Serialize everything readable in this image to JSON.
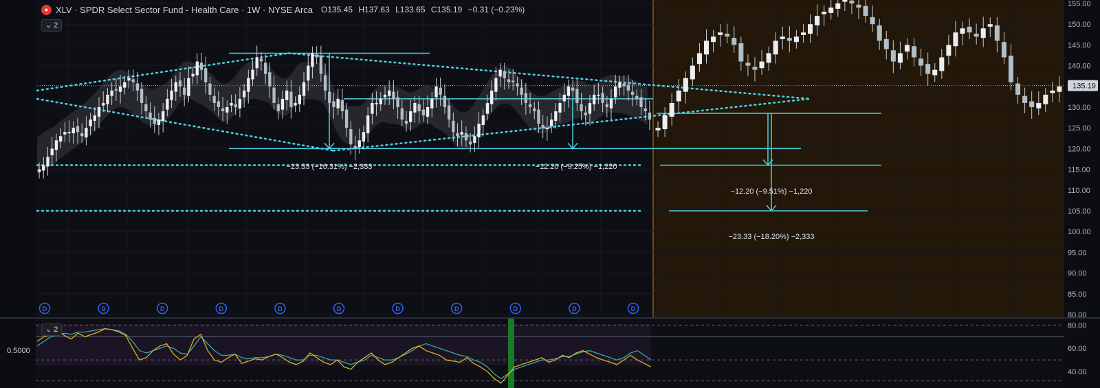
{
  "header": {
    "logo": "●",
    "title": "XLV · SPDR Select Sector Fund - Health Care · 1W · NYSE Arca",
    "open": "O135.45",
    "high": "H137.63",
    "low": "L133.65",
    "close": "C135.19",
    "change": "−0.31 (−0.23%)"
  },
  "main_pane": {
    "collapse_label": "2"
  },
  "osc_pane": {
    "collapse_label": "2",
    "left_label": "0.5000"
  },
  "price_axis": {
    "labels": [
      "155.00",
      "150.00",
      "145.00",
      "140.00",
      "135.00",
      "130.00",
      "125.00",
      "120.00",
      "115.00",
      "110.00",
      "105.00",
      "100.00",
      "95.00",
      "90.00",
      "85.00",
      "80.00"
    ],
    "last_price": "135.19"
  },
  "osc_axis": {
    "labels": [
      "80.00",
      "60.00",
      "40.00"
    ]
  },
  "annotations": [
    "−23.33 (−16.31%) −2,333",
    "−12.20 (−9.25%) −1,220",
    "−12.20 (−9.51%) −1,220",
    "−23.33 (−18.20%) −2,333"
  ],
  "dividend_marker": "D",
  "colors": {
    "background": "#0c0d12",
    "projection": "#221708",
    "projection_border": "#8a5a20",
    "drawing": "#4dd0e1",
    "candle_up": "#eceff1",
    "candle_down": "#b0bec5",
    "band": "#2a2b31",
    "osc_fast": "#e0b020",
    "osc_slow": "#3aa7a0",
    "osc_highlight": "#1b7a28",
    "accent_red": "#e53935"
  },
  "chart_data": {
    "type": "candlestick",
    "y_scale": {
      "min": 80,
      "max": 155
    },
    "last_close": 135.19,
    "weekly_closes": [
      115,
      116,
      118,
      120,
      122,
      123,
      124,
      124,
      125,
      124,
      123,
      125,
      127,
      128,
      130,
      131,
      133,
      134,
      134,
      135,
      136,
      137,
      136,
      134,
      131,
      129,
      127,
      126,
      127,
      129,
      132,
      134,
      136,
      135,
      133,
      137,
      138,
      141,
      139,
      136,
      133,
      131,
      130,
      129,
      130,
      131,
      130,
      132,
      134,
      137,
      139,
      142,
      141,
      138,
      135,
      131,
      129,
      132,
      134,
      130,
      131,
      133,
      136,
      140,
      143,
      142,
      138,
      134,
      131,
      130,
      132,
      129,
      125,
      121,
      120,
      122,
      124,
      128,
      131,
      131,
      132,
      133,
      134,
      132,
      130,
      127,
      126,
      129,
      131,
      129,
      128,
      130,
      132,
      135,
      133,
      130,
      127,
      124,
      123,
      124,
      122,
      121,
      123,
      126,
      128,
      131,
      134,
      137,
      139,
      137,
      136,
      136,
      135,
      133,
      131,
      130,
      129,
      126,
      125,
      125,
      127,
      129,
      131,
      133,
      135,
      134,
      131,
      129,
      128,
      131,
      133,
      133,
      131,
      130,
      132,
      135,
      136,
      135,
      134,
      133,
      132,
      130,
      129,
      127
    ],
    "projection_closes": [
      125,
      128,
      131,
      134,
      137,
      140,
      143,
      146,
      147,
      148,
      147,
      145,
      141,
      140,
      139,
      141,
      143,
      146,
      147,
      146,
      147,
      148,
      150,
      152,
      153,
      154,
      155,
      156,
      155,
      154,
      152,
      150,
      146,
      144,
      141,
      143,
      145,
      142,
      140,
      138,
      139,
      142,
      145,
      148,
      149,
      148,
      147,
      149,
      150,
      146,
      142,
      136,
      133,
      131,
      130,
      131,
      133,
      134,
      135
    ]
  },
  "osc_data": {
    "fast": [
      66,
      70,
      72,
      75,
      71,
      68,
      73,
      70,
      72,
      74,
      77,
      76,
      74,
      71,
      60,
      50,
      52,
      58,
      62,
      64,
      55,
      50,
      54,
      68,
      72,
      58,
      50,
      48,
      52,
      55,
      47,
      49,
      51,
      50,
      53,
      55,
      52,
      48,
      46,
      49,
      56,
      52,
      48,
      46,
      50,
      44,
      42,
      48,
      52,
      56,
      50,
      46,
      48,
      52,
      56,
      60,
      62,
      58,
      56,
      54,
      50,
      49,
      48,
      52,
      47,
      44,
      40,
      34,
      30,
      37,
      44,
      46,
      48,
      50,
      52,
      48,
      50,
      54,
      52,
      56,
      58,
      55,
      52,
      50,
      48,
      46,
      50,
      54,
      50,
      47,
      44
    ],
    "slow": [
      62,
      66,
      70,
      72,
      73,
      72,
      74,
      74,
      75,
      76,
      77,
      76,
      75,
      72,
      66,
      58,
      56,
      58,
      60,
      62,
      60,
      56,
      55,
      62,
      70,
      64,
      58,
      54,
      54,
      55,
      52,
      51,
      52,
      52,
      53,
      55,
      54,
      52,
      50,
      50,
      54,
      54,
      52,
      50,
      50,
      48,
      46,
      48,
      50,
      54,
      52,
      50,
      50,
      52,
      55,
      58,
      62,
      64,
      62,
      60,
      58,
      56,
      54,
      53,
      50,
      48,
      44,
      38,
      34,
      38,
      42,
      44,
      46,
      48,
      50,
      50,
      51,
      53,
      53,
      55,
      57,
      58,
      56,
      54,
      52,
      50,
      52,
      56,
      58,
      54,
      50
    ]
  }
}
